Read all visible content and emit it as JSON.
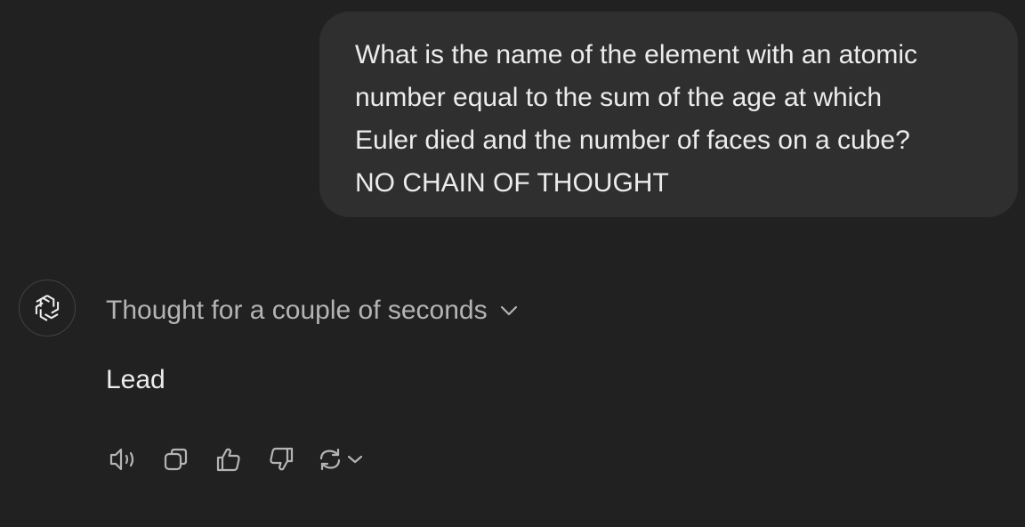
{
  "user_message": {
    "lines": [
      "What is the name of the element with an atomic",
      "number equal to the sum of the age at which",
      "Euler died and the number of faces on a cube?",
      "NO CHAIN OF THOUGHT"
    ]
  },
  "assistant": {
    "avatar_icon": "openai-logo-icon",
    "thought_label": "Thought for a couple of seconds",
    "answer": "Lead",
    "actions": [
      {
        "icon": "speaker-icon"
      },
      {
        "icon": "copy-icon"
      },
      {
        "icon": "thumbs-up-icon"
      },
      {
        "icon": "thumbs-down-icon"
      },
      {
        "icon": "regenerate-icon"
      }
    ]
  },
  "colors": {
    "background": "#212121",
    "bubble": "#2f2f2f",
    "text": "#ececec",
    "muted": "#b4b4b4",
    "icon": "#b4b4b4"
  }
}
